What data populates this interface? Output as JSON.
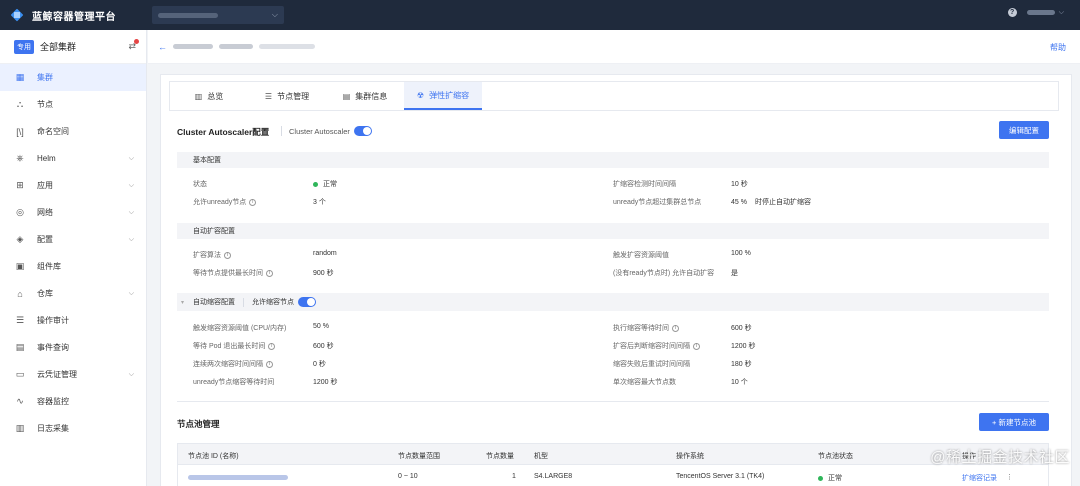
{
  "app": {
    "title": "蓝鲸容器管理平台",
    "help_symbol": "?"
  },
  "topbar": {
    "select_chevron": "⌵",
    "user_chevron": "⌵"
  },
  "sidebar": {
    "badge": "专用",
    "cluster_name": "全部集群",
    "switch_symbol": "⇄",
    "items": [
      {
        "label": "集群",
        "icon": "grid-icon",
        "glyph": "▦",
        "active": true,
        "expandable": false
      },
      {
        "label": "节点",
        "icon": "node-icon",
        "glyph": "⛬",
        "active": false,
        "expandable": false
      },
      {
        "label": "命名空间",
        "icon": "namespace-icon",
        "glyph": "[\\]",
        "active": false,
        "expandable": false
      },
      {
        "label": "Helm",
        "icon": "helm-icon",
        "glyph": "⎈",
        "active": false,
        "expandable": true
      },
      {
        "label": "应用",
        "icon": "app-icon",
        "glyph": "⊞",
        "active": false,
        "expandable": true
      },
      {
        "label": "网络",
        "icon": "network-icon",
        "glyph": "◎",
        "active": false,
        "expandable": true
      },
      {
        "label": "配置",
        "icon": "config-icon",
        "glyph": "◈",
        "active": false,
        "expandable": true
      },
      {
        "label": "组件库",
        "icon": "component-icon",
        "glyph": "▣",
        "active": false,
        "expandable": false
      },
      {
        "label": "仓库",
        "icon": "repo-icon",
        "glyph": "⌂",
        "active": false,
        "expandable": true
      },
      {
        "label": "操作审计",
        "icon": "audit-icon",
        "glyph": "☰",
        "active": false,
        "expandable": false
      },
      {
        "label": "事件查询",
        "icon": "event-icon",
        "glyph": "▤",
        "active": false,
        "expandable": false
      },
      {
        "label": "云凭证管理",
        "icon": "cloud-credential-icon",
        "glyph": "▭",
        "active": false,
        "expandable": true
      },
      {
        "label": "容器监控",
        "icon": "monitor-icon",
        "glyph": "∿",
        "active": false,
        "expandable": false
      },
      {
        "label": "日志采集",
        "icon": "log-icon",
        "glyph": "▥",
        "active": false,
        "expandable": false
      }
    ],
    "expand_symbol": "⌵"
  },
  "breadcrumb": {
    "back_symbol": "←",
    "help": "帮助"
  },
  "tabs": [
    {
      "label": "总览",
      "icon": "chart-icon",
      "glyph": "▥",
      "active": false
    },
    {
      "label": "节点管理",
      "icon": "list-icon",
      "glyph": "☰",
      "active": false
    },
    {
      "label": "集群信息",
      "icon": "info-icon",
      "glyph": "▤",
      "active": false
    },
    {
      "label": "弹性扩缩容",
      "icon": "autoscale-icon",
      "glyph": "☢",
      "active": true
    }
  ],
  "autoscaler": {
    "title": "Cluster Autoscaler配置",
    "toggle_label": "Cluster Autoscaler",
    "edit_button": "编辑配置",
    "basic": {
      "title": "基本配置",
      "status_label": "状态",
      "status_value": "正常",
      "unready_label": "允许unready节点",
      "unready_value": "3 个",
      "scan_label": "扩缩容检测时间间隔",
      "scan_value": "10 秒",
      "ratio_label": "unready节点超过集群总节点",
      "ratio_value": "45 %",
      "ratio_note": "时停止自动扩缩容"
    },
    "scale_up": {
      "title": "自动扩容配置",
      "algo_label": "扩容算法",
      "algo_value": "random",
      "wait_label": "等待节点提供最长时间",
      "wait_value": "900 秒",
      "trigger_label": "触发扩容资源阈值",
      "trigger_value": "100 %",
      "noready_label": "(没有ready节点时) 允许自动扩容",
      "noready_value": "是"
    },
    "scale_down": {
      "title": "自动缩容配置",
      "toggle_label": "允许缩容节点",
      "rows_left": [
        {
          "label": "触发缩容资源阈值 (CPU/内存)",
          "value": "50 %",
          "info": false
        },
        {
          "label": "等待 Pod 退出最长时间",
          "value": "600 秒",
          "info": true
        },
        {
          "label": "连续两次缩容时间间隔",
          "value": "0 秒",
          "info": true
        },
        {
          "label": "unready节点缩容等待时间",
          "value": "1200 秒",
          "info": false
        }
      ],
      "rows_right": [
        {
          "label": "执行缩容等待时间",
          "value": "600 秒",
          "info": true
        },
        {
          "label": "扩容后判断缩容时间间隔",
          "value": "1200 秒",
          "info": true
        },
        {
          "label": "缩容失败后重试时间间隔",
          "value": "180 秒",
          "info": false
        },
        {
          "label": "单次缩容最大节点数",
          "value": "10 个",
          "info": false
        }
      ]
    }
  },
  "info_symbol": "i",
  "pool": {
    "title": "节点池管理",
    "new_button": "+ 新建节点池",
    "columns": [
      "节点池 ID (名称)",
      "节点数量范围",
      "节点数量",
      "机型",
      "操作系统",
      "节点池状态",
      "操作"
    ],
    "rows": [
      {
        "range": "0 ~ 10",
        "count": "1",
        "type": "S4.LARGE8",
        "os": "TencentOS Server 3.1 (TK4)",
        "status": "正常",
        "action": "扩缩容记录",
        "more": "⋮"
      }
    ]
  },
  "watermark": "@稀土掘金技术社区"
}
